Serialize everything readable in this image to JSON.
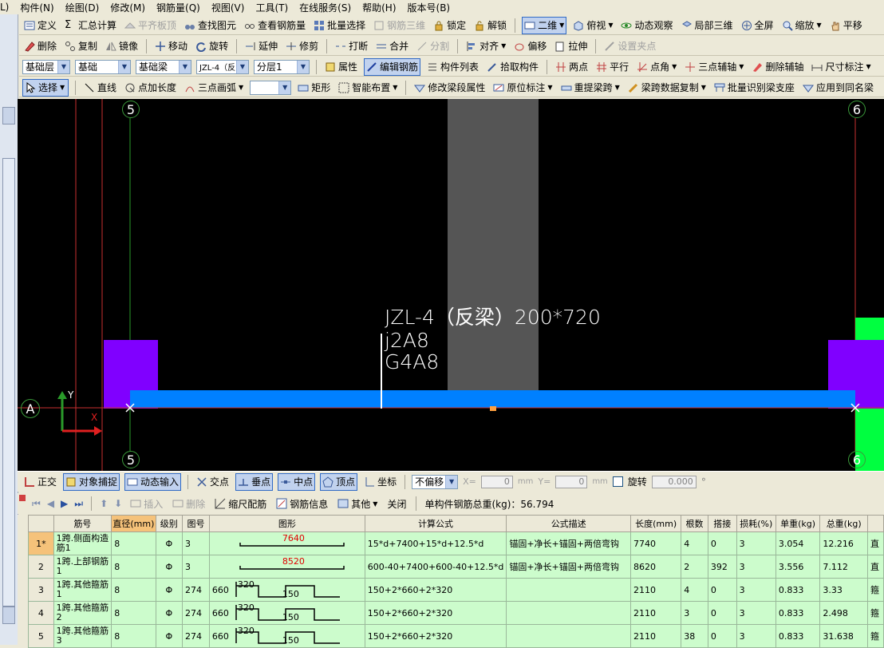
{
  "menu": [
    "L)",
    "构件(N)",
    "绘图(D)",
    "修改(M)",
    "钢筋量(Q)",
    "视图(V)",
    "工具(T)",
    "在线服务(S)",
    "帮助(H)",
    "版本号(B)"
  ],
  "toolbar1": {
    "define": "定义",
    "sum_calc": "汇总计算",
    "flat_board": "平齐板顶",
    "find_elem": "查找图元",
    "view_rebar": "查看钢筋量",
    "batch_select": "批量选择",
    "rebar_3d": "钢筋三维",
    "lock": "锁定",
    "unlock": "解锁",
    "view_mode": "二维",
    "view_dir": "俯视",
    "dynamic_view": "动态观察",
    "local_3d": "局部三维",
    "fullscreen": "全屏",
    "zoom": "缩放",
    "pan": "平移"
  },
  "toolbar2": {
    "delete": "删除",
    "copy": "复制",
    "mirror": "镜像",
    "move": "移动",
    "rotate": "旋转",
    "extend": "延伸",
    "trim": "修剪",
    "break": "打断",
    "merge": "合并",
    "split": "分割",
    "align": "对齐",
    "offset": "偏移",
    "stretch": "拉伸",
    "set_point": "设置夹点"
  },
  "toolbar3": {
    "layer_group": "基础层",
    "layer_type": "基础",
    "elem_type": "基础梁",
    "elem_name": "JZL-4（反",
    "sub_layer": "分层1",
    "props": "属性",
    "edit_rebar": "编辑钢筋",
    "elem_list": "构件列表",
    "pick_elem": "拾取构件",
    "two_point": "两点",
    "parallel": "平行",
    "point_angle": "点角",
    "three_point_aux": "三点辅轴",
    "del_aux": "删除辅轴",
    "dim": "尺寸标注"
  },
  "toolbar4": {
    "select": "选择",
    "line": "直线",
    "point_len": "点加长度",
    "arc3": "三点画弧",
    "rect": "矩形",
    "smart_place": "智能布置",
    "modify_seg": "修改梁段属性",
    "in_situ": "原位标注",
    "redo_span": "重提梁跨",
    "copy_span": "梁跨数据复制",
    "batch_support": "批量识别梁支座",
    "apply_same": "应用到同名梁"
  },
  "canvas": {
    "axis_top_left": "5",
    "axis_top_right": "6",
    "axis_bottom_left": "5",
    "axis_bottom_right": "6",
    "axis_a": "A",
    "beam_label": "JZL-4（反梁）200*720",
    "beam_rebar1": "j2A8",
    "beam_rebar2": "G4A8",
    "y_axis": "Y",
    "x_axis": "X"
  },
  "statusbar": {
    "ortho": "正交",
    "snap": "对象捕捉",
    "dyn_input": "动态输入",
    "intersect": "交点",
    "perp": "垂点",
    "mid": "中点",
    "vertex": "顶点",
    "coord": "坐标",
    "offset_mode": "不偏移",
    "x_label": "X=",
    "x_val": "0",
    "x_unit": "mm",
    "y_label": "Y=",
    "y_val": "0",
    "y_unit": "mm",
    "rotate": "旋转",
    "rotate_val": "0.000",
    "deg": "°"
  },
  "gridbar": {
    "insert": "插入",
    "delete": "删除",
    "scale": "缩尺配筋",
    "info": "钢筋信息",
    "other": "其他",
    "close": "关闭",
    "total": "单构件钢筋总重(kg)：56.794"
  },
  "columns": [
    "筋号",
    "直径(mm)",
    "级别",
    "图号",
    "图形",
    "计算公式",
    "公式描述",
    "长度(mm)",
    "根数",
    "搭接",
    "损耗(%)",
    "单重(kg)",
    "总重(kg)",
    ""
  ],
  "rows": [
    {
      "no": "1*",
      "name": "1跨.侧面构造筋1",
      "dia": "8",
      "grade": "Φ",
      "fig": "3",
      "shape_a": "",
      "shape_b": "7640",
      "shape_c": "",
      "formula": "15*d+7400+15*d+12.5*d",
      "desc": "锚固+净长+锚固+两倍弯钩",
      "len": "7740",
      "count": "4",
      "lap": "0",
      "loss": "3",
      "unit": "3.054",
      "total": "12.216",
      "extra": "直"
    },
    {
      "no": "2",
      "name": "1跨.上部钢筋1",
      "dia": "8",
      "grade": "Φ",
      "fig": "3",
      "shape_a": "",
      "shape_b": "8520",
      "shape_c": "",
      "formula": "600-40+7400+600-40+12.5*d",
      "desc": "锚固+净长+锚固+两倍弯钩",
      "len": "8620",
      "count": "2",
      "lap": "392",
      "loss": "3",
      "unit": "3.556",
      "total": "7.112",
      "extra": "直"
    },
    {
      "no": "3",
      "name": "1跨.其他箍筋1",
      "dia": "8",
      "grade": "Φ",
      "fig": "274",
      "shape_a": "660",
      "shape_b": "320",
      "shape_c": "150",
      "formula": "150+2*660+2*320",
      "desc": "",
      "len": "2110",
      "count": "4",
      "lap": "0",
      "loss": "3",
      "unit": "0.833",
      "total": "3.33",
      "extra": "箍"
    },
    {
      "no": "4",
      "name": "1跨.其他箍筋2",
      "dia": "8",
      "grade": "Φ",
      "fig": "274",
      "shape_a": "660",
      "shape_b": "320",
      "shape_c": "150",
      "formula": "150+2*660+2*320",
      "desc": "",
      "len": "2110",
      "count": "3",
      "lap": "0",
      "loss": "3",
      "unit": "0.833",
      "total": "2.498",
      "extra": "箍"
    },
    {
      "no": "5",
      "name": "1跨.其他箍筋3",
      "dia": "8",
      "grade": "Φ",
      "fig": "274",
      "shape_a": "660",
      "shape_b": "320",
      "shape_c": "150",
      "formula": "150+2*660+2*320",
      "desc": "",
      "len": "2110",
      "count": "38",
      "lap": "0",
      "loss": "3",
      "unit": "0.833",
      "total": "31.638",
      "extra": "箍"
    }
  ]
}
